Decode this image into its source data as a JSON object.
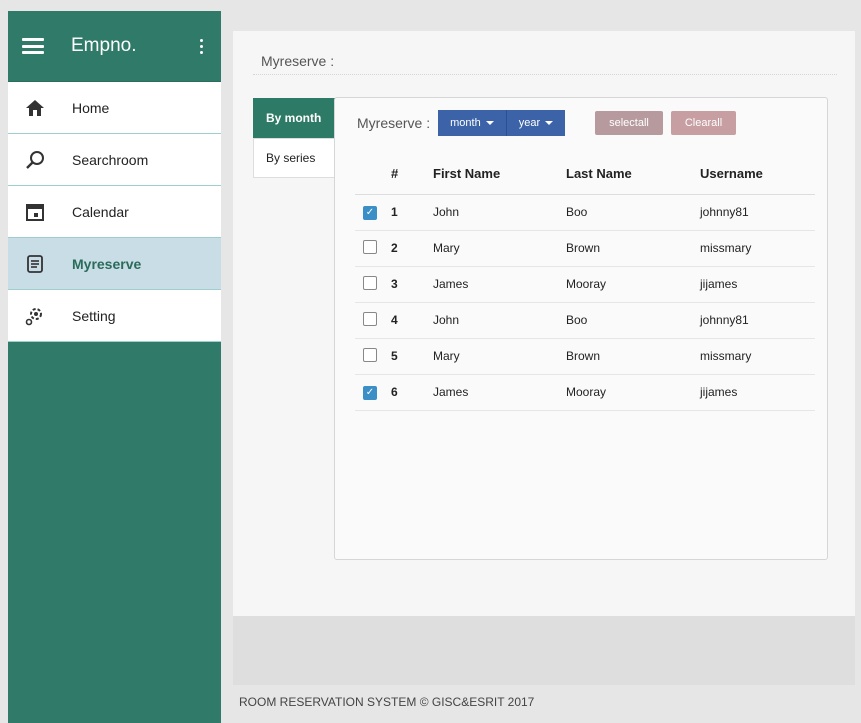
{
  "sidebar": {
    "title": "Empno.",
    "items": [
      {
        "label": "Home",
        "icon": "home-icon"
      },
      {
        "label": "Searchroom",
        "icon": "search-icon"
      },
      {
        "label": "Calendar",
        "icon": "calendar-icon"
      },
      {
        "label": "Myreserve",
        "icon": "document-icon",
        "active": true
      },
      {
        "label": "Setting",
        "icon": "gear-icon"
      }
    ]
  },
  "main": {
    "title": "Myreserve :",
    "tabs": [
      "By month",
      "By series"
    ],
    "toolbar": {
      "label": "Myreserve :",
      "month": "month",
      "year": "year",
      "select_all": "selectall",
      "clear_all": "Clearall"
    },
    "table": {
      "headers": [
        "#",
        "First Name",
        "Last Name",
        "Username"
      ],
      "rows": [
        {
          "checked": true,
          "num": "1",
          "first": "John",
          "last": "Boo",
          "user": "johnny81"
        },
        {
          "checked": false,
          "num": "2",
          "first": "Mary",
          "last": "Brown",
          "user": "missmary"
        },
        {
          "checked": false,
          "num": "3",
          "first": "James",
          "last": "Mooray",
          "user": "jijames"
        },
        {
          "checked": false,
          "num": "4",
          "first": "John",
          "last": "Boo",
          "user": "johnny81"
        },
        {
          "checked": false,
          "num": "5",
          "first": "Mary",
          "last": "Brown",
          "user": "missmary"
        },
        {
          "checked": true,
          "num": "6",
          "first": "James",
          "last": "Mooray",
          "user": "jijames"
        }
      ]
    }
  },
  "footer": "ROOM RESERVATION SYSTEM © GISC&ESRIT 2017",
  "colors": {
    "sidebar": "#2f7a68",
    "accent": "#2d7b66",
    "dropdown": "#3c63a8",
    "button": "#b79a9e"
  }
}
